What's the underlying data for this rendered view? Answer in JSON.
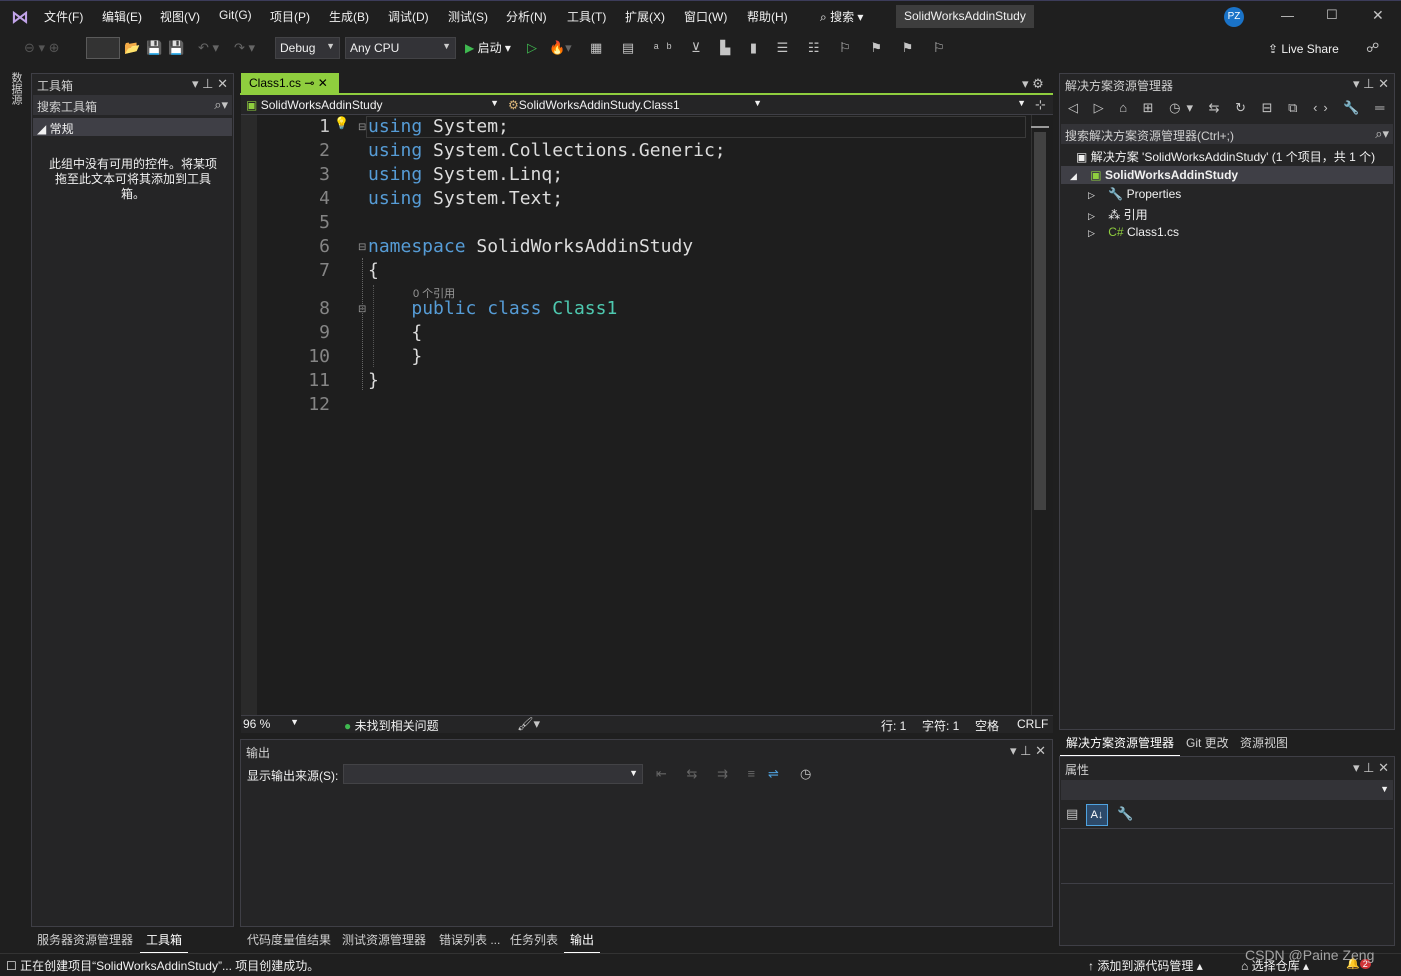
{
  "menus": [
    "文件(F)",
    "编辑(E)",
    "视图(V)",
    "Git(G)",
    "项目(P)",
    "生成(B)",
    "调试(D)",
    "测试(S)",
    "分析(N)",
    "工具(T)",
    "扩展(X)",
    "窗口(W)",
    "帮助(H)"
  ],
  "search_label": "搜索",
  "window_title": "SolidWorksAddinStudy",
  "avatar": "PZ",
  "live_share": "Live Share",
  "config": "Debug",
  "platform": "Any CPU",
  "start": "启动",
  "datasource_tab": "数据源",
  "toolbox": {
    "title": "工具箱",
    "search": "搜索工具箱",
    "group": "常规",
    "empty": "此组中没有可用的控件。将某项拖至此文本可将其添加到工具箱。"
  },
  "left_bottom_tabs": [
    "服务器资源管理器",
    "工具箱"
  ],
  "editor": {
    "tab": "Class1.cs",
    "nav_project": "SolidWorksAddinStudy",
    "nav_class": "SolidWorksAddinStudy.Class1",
    "codelens": "0 个引用",
    "zoom": "96 %",
    "issues": "未找到相关问题",
    "row": "行: 1",
    "col": "字符: 1",
    "space": "空格",
    "eol": "CRLF"
  },
  "line_numbers": [
    "1",
    "2",
    "3",
    "4",
    "5",
    "6",
    "7",
    "8",
    "9",
    "10",
    "11",
    "12"
  ],
  "code": [
    [
      [
        "kw",
        "using"
      ],
      [
        "pl",
        " System;"
      ]
    ],
    [
      [
        "kw",
        "using"
      ],
      [
        "pl",
        " System.Collections.Generic;"
      ]
    ],
    [
      [
        "kw",
        "using"
      ],
      [
        "pl",
        " System.Linq;"
      ]
    ],
    [
      [
        "kw",
        "using"
      ],
      [
        "pl",
        " System.Text;"
      ]
    ],
    [],
    [
      [
        "kw",
        "namespace"
      ],
      [
        "pl",
        " SolidWorksAddinStudy"
      ]
    ],
    [
      [
        "pl",
        "{"
      ]
    ],
    [
      [
        "pl",
        "    "
      ],
      [
        "kw",
        "public"
      ],
      [
        "pl",
        " "
      ],
      [
        "kw",
        "class"
      ],
      [
        "pl",
        " "
      ],
      [
        "cls",
        "Class1"
      ]
    ],
    [
      [
        "pl",
        "    {"
      ]
    ],
    [
      [
        "pl",
        "    }"
      ]
    ],
    [
      [
        "pl",
        "}"
      ]
    ],
    []
  ],
  "output": {
    "title": "输出",
    "source_label": "显示输出来源(S):"
  },
  "bottom_tabs": [
    "代码度量值结果",
    "测试资源管理器",
    "错误列表 ...",
    "任务列表",
    "输出"
  ],
  "solution": {
    "title": "解决方案资源管理器",
    "search": "搜索解决方案资源管理器(Ctrl+;)",
    "root": "解决方案 'SolidWorksAddinStudy' (1 个项目，共 1 个)",
    "project": "SolidWorksAddinStudy",
    "items": [
      "Properties",
      "引用",
      "Class1.cs"
    ]
  },
  "right_tabs": [
    "解决方案资源管理器",
    "Git 更改",
    "资源视图"
  ],
  "properties_title": "属性",
  "status": {
    "text": "正在创建项目“SolidWorksAddinStudy”... 项目创建成功。",
    "source_ctrl": "添加到源代码管理",
    "repo": "选择仓库",
    "watermark": "CSDN @Paine Zeng"
  },
  "colors": {
    "accent": "#007acc",
    "status_bar": "#1f1f1f",
    "keyword": "#569cd6",
    "class": "#4ec9b0"
  }
}
